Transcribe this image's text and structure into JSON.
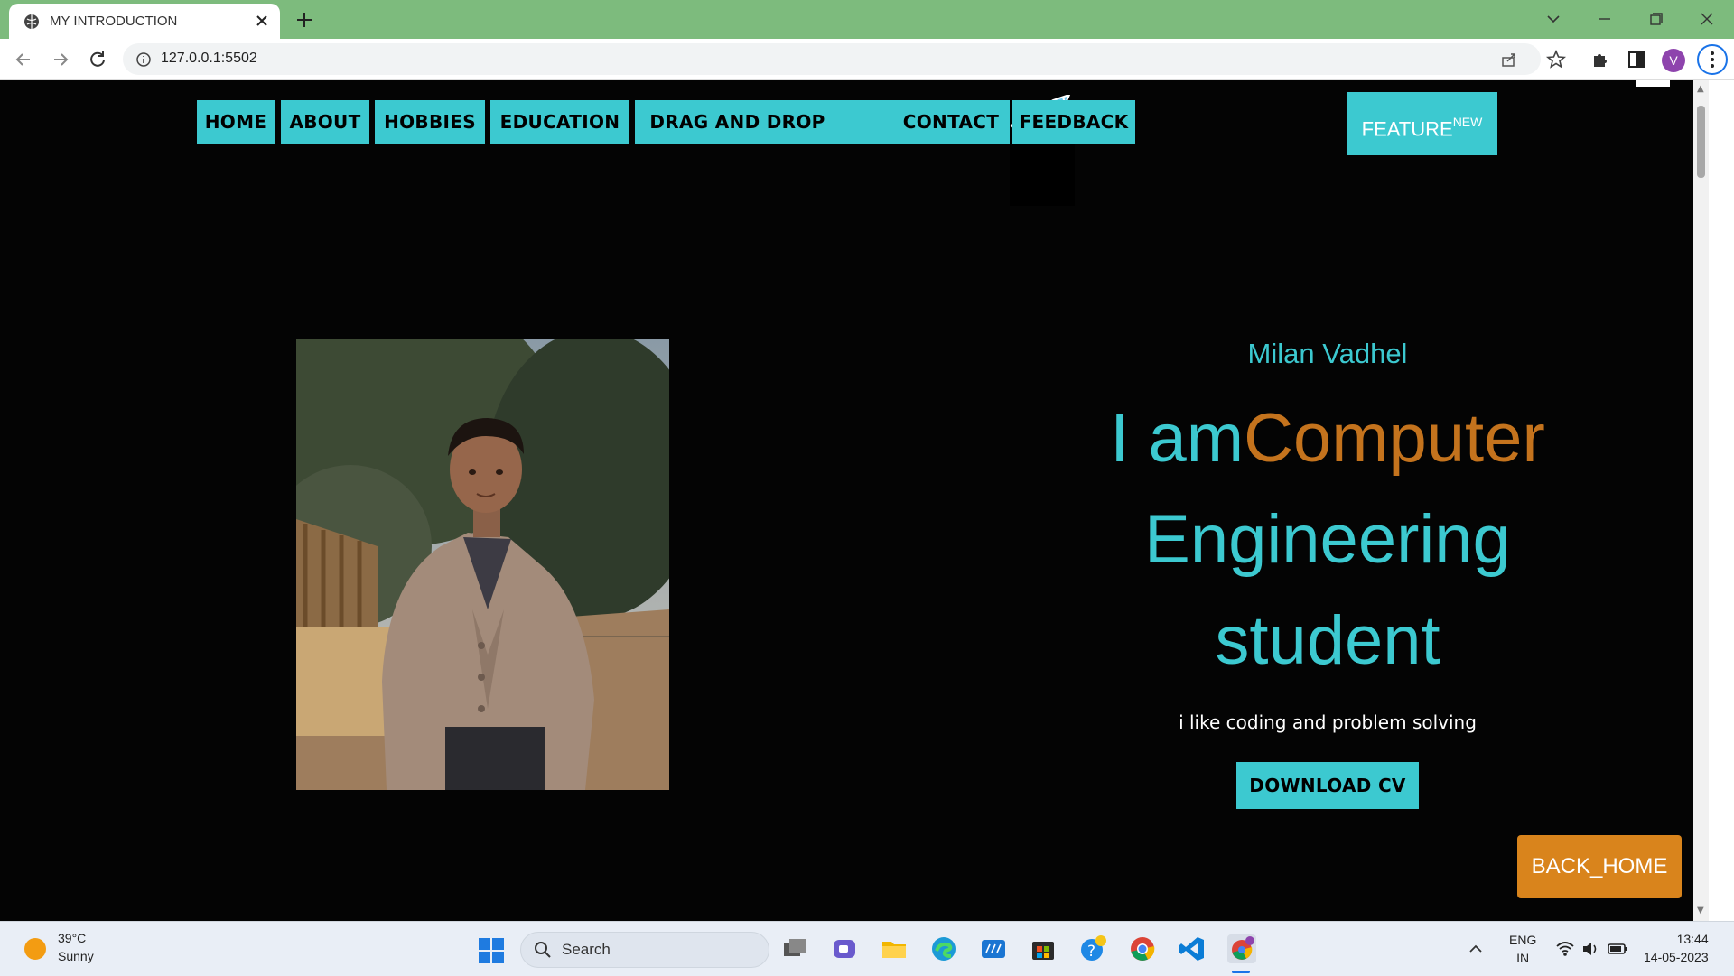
{
  "browser": {
    "tab_title": "MY INTRODUCTION",
    "url": "127.0.0.1:5502",
    "profile_initial": "V"
  },
  "nav": {
    "items": [
      "HOME",
      "ABOUT",
      "HOBBIES",
      "EDUCATION",
      "DRAG AND DROP",
      "CONTACT",
      "FEEDBACK"
    ],
    "new_badge": "NEW"
  },
  "feature_button": {
    "label": "FEATURE",
    "sup": "NEW"
  },
  "hero": {
    "name": "Milan Vadhel",
    "intro": "I am",
    "role": "Computer",
    "rest_line1": "Engineering",
    "rest_line2": "student",
    "tagline": "i like coding and problem solving",
    "cv_button": "DOWNLOAD CV"
  },
  "back_home": "BACK_HOME",
  "taskbar": {
    "weather_temp": "39°C",
    "weather_desc": "Sunny",
    "search_label": "Search",
    "lang_line1": "ENG",
    "lang_line2": "IN",
    "time": "13:44",
    "date": "14-05-2023"
  },
  "colors": {
    "accent": "#3cc9d0",
    "role_text": "#c4731d",
    "back_home_bg": "#d9841c",
    "page_bg": "#040404",
    "tabbar_bg": "#7dbb7d"
  }
}
